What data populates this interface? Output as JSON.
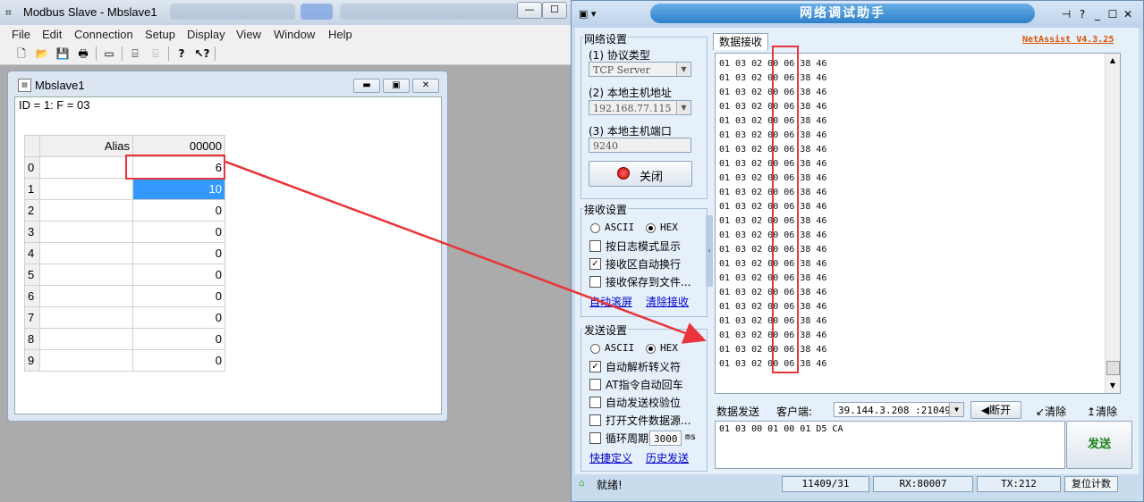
{
  "modbus": {
    "window_title": "Modbus Slave - Mbslave1",
    "menu": [
      "File",
      "Edit",
      "Connection",
      "Setup",
      "Display",
      "View",
      "Window",
      "Help"
    ],
    "child": {
      "title": "Mbslave1",
      "id_line": "ID = 1: F = 03",
      "headers": [
        "Alias",
        "00000"
      ],
      "rows": [
        {
          "index": "0",
          "value": "6"
        },
        {
          "index": "1",
          "value": "10"
        },
        {
          "index": "2",
          "value": "0"
        },
        {
          "index": "3",
          "value": "0"
        },
        {
          "index": "4",
          "value": "0"
        },
        {
          "index": "5",
          "value": "0"
        },
        {
          "index": "6",
          "value": "0"
        },
        {
          "index": "7",
          "value": "0"
        },
        {
          "index": "8",
          "value": "0"
        },
        {
          "index": "9",
          "value": "0"
        }
      ],
      "selected_row": 1
    }
  },
  "netassist": {
    "title": "网络调试助手",
    "brand": "NetAssist V4.3.25",
    "net_settings": {
      "group_label": "网络设置",
      "protocol_label": "(1) 协议类型",
      "protocol_value": "TCP Server",
      "host_label": "(2) 本地主机地址",
      "host_value": "192.168.77.115",
      "port_label": "(3) 本地主机端口",
      "port_value": "9240",
      "close_button": "关闭"
    },
    "recv_settings": {
      "group_label": "接收设置",
      "ascii": "ASCII",
      "hex": "HEX",
      "log_mode": "按日志模式显示",
      "auto_wrap": "接收区自动换行",
      "save_to_file": "接收保存到文件...",
      "auto_scroll": "自动滚屏",
      "clear_recv": "清除接收"
    },
    "send_settings": {
      "group_label": "发送设置",
      "ascii": "ASCII",
      "hex": "HEX",
      "parse_escape": "自动解析转义符",
      "at_cr": "AT指令自动回车",
      "auto_checksum": "自动发送校验位",
      "open_file": "打开文件数据源...",
      "loop_period": "循环周期",
      "loop_value": "3000",
      "loop_unit": "ms",
      "shortcut": "快捷定义",
      "history": "历史发送"
    },
    "recv_tab": "数据接收",
    "recv_lines": [
      "01 03 02 00 06 38 46",
      "01 03 02 00 06 38 46",
      "01 03 02 00 06 38 46",
      "01 03 02 00 06 38 46",
      "01 03 02 00 06 38 46",
      "01 03 02 00 06 38 46",
      "01 03 02 00 06 38 46",
      "01 03 02 00 06 38 46",
      "01 03 02 00 06 38 46",
      "01 03 02 00 06 38 46",
      "01 03 02 00 06 38 46",
      "01 03 02 00 06 38 46",
      "01 03 02 00 06 38 46",
      "01 03 02 00 06 38 46",
      "01 03 02 00 06 38 46",
      "01 03 02 00 06 38 46",
      "01 03 02 00 06 38 46",
      "01 03 02 00 06 38 46",
      "01 03 02 00 06 38 46",
      "01 03 02 00 06 38 46",
      "01 03 02 00 06 38 46",
      "01 03 02 00 06 38 46"
    ],
    "send_tab": "数据发送",
    "client_label": "客户端:",
    "client_value": "39.144.3.208 :21049",
    "disconnect_button": "断开",
    "clear1": "清除",
    "clear2": "清除",
    "send_text": "01 03 00 01 00 01 D5 CA",
    "send_button": "发送",
    "status": {
      "ready": "就绪!",
      "count": "11409/31",
      "rx": "RX:80007",
      "tx": "TX:212",
      "reset": "复位计数"
    }
  }
}
